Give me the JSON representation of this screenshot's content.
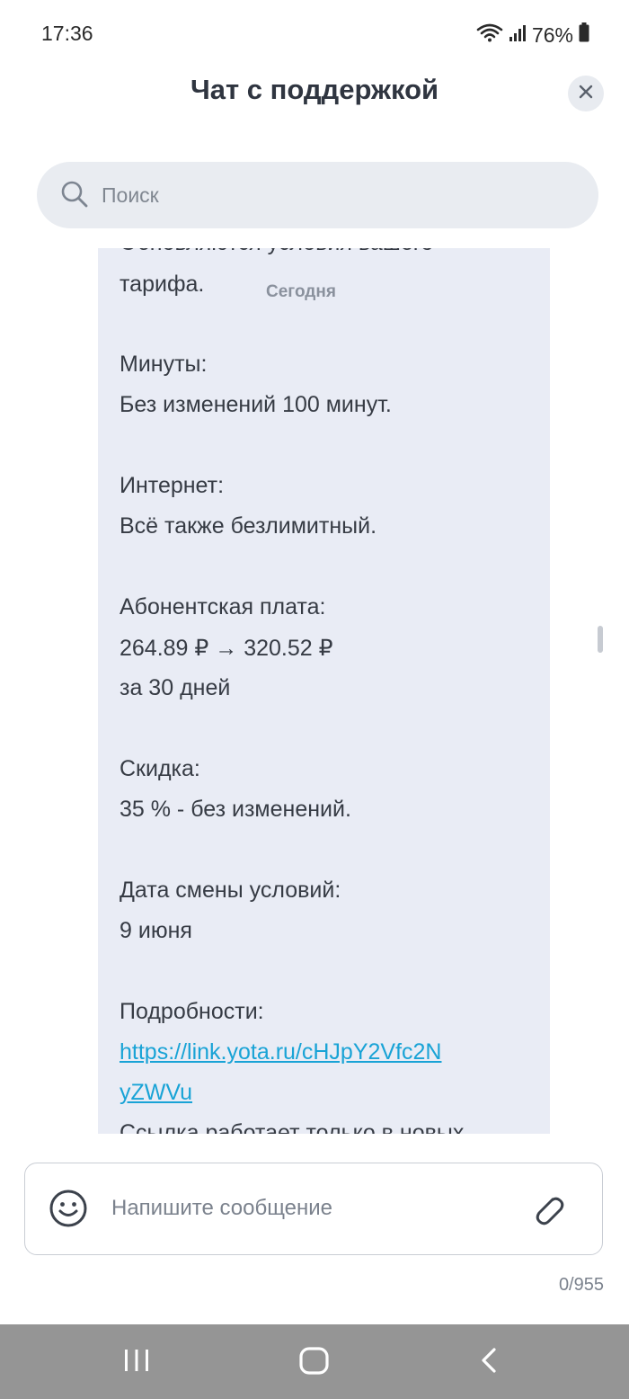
{
  "status_bar": {
    "time": "17:36",
    "battery": "76%",
    "icons": [
      "wifi-icon",
      "signal-icon",
      "battery-icon"
    ]
  },
  "header": {
    "title": "Чат с поддержкой",
    "close_icon": "close-icon"
  },
  "search": {
    "placeholder": "Поиск",
    "icon": "search-icon"
  },
  "message": {
    "top_line_partial": "Обновляются условия вашего",
    "line_tariff": "тарифа.",
    "time": "Сегодня",
    "minutes_label": "Минуты:",
    "minutes_value": "Без изменений 100 минут.",
    "internet_label": "Интернет:",
    "internet_value": "Всё также безлимитный.",
    "fee_label": "Абонентская плата:",
    "fee_value": "264.89 ₽ → 320.52 ₽",
    "fee_period": "за 30 дней",
    "discount_label": "Скидка:",
    "discount_value": "35 % - без изменений.",
    "date_label": "Дата смены условий:",
    "date_value": "9 июня",
    "details_label": "Подробности:",
    "link_line1": "https://link.yota.ru/cHJpY2Vfc2N",
    "link_line2": "yZWVu",
    "bottom_line_partial": "Ссылка работает только в новых"
  },
  "composer": {
    "placeholder": "Напишите сообщение",
    "counter": "0/955",
    "emoji_icon": "emoji-icon",
    "attach_icon": "paperclip-icon"
  },
  "nav_bar": {
    "icons": [
      "recents-icon",
      "home-icon",
      "back-icon"
    ]
  },
  "colors": {
    "bubble_bg": "#e9ecf5",
    "link": "#19a3d6",
    "search_bg": "#e9ecf1",
    "nav_bg": "#959595"
  }
}
